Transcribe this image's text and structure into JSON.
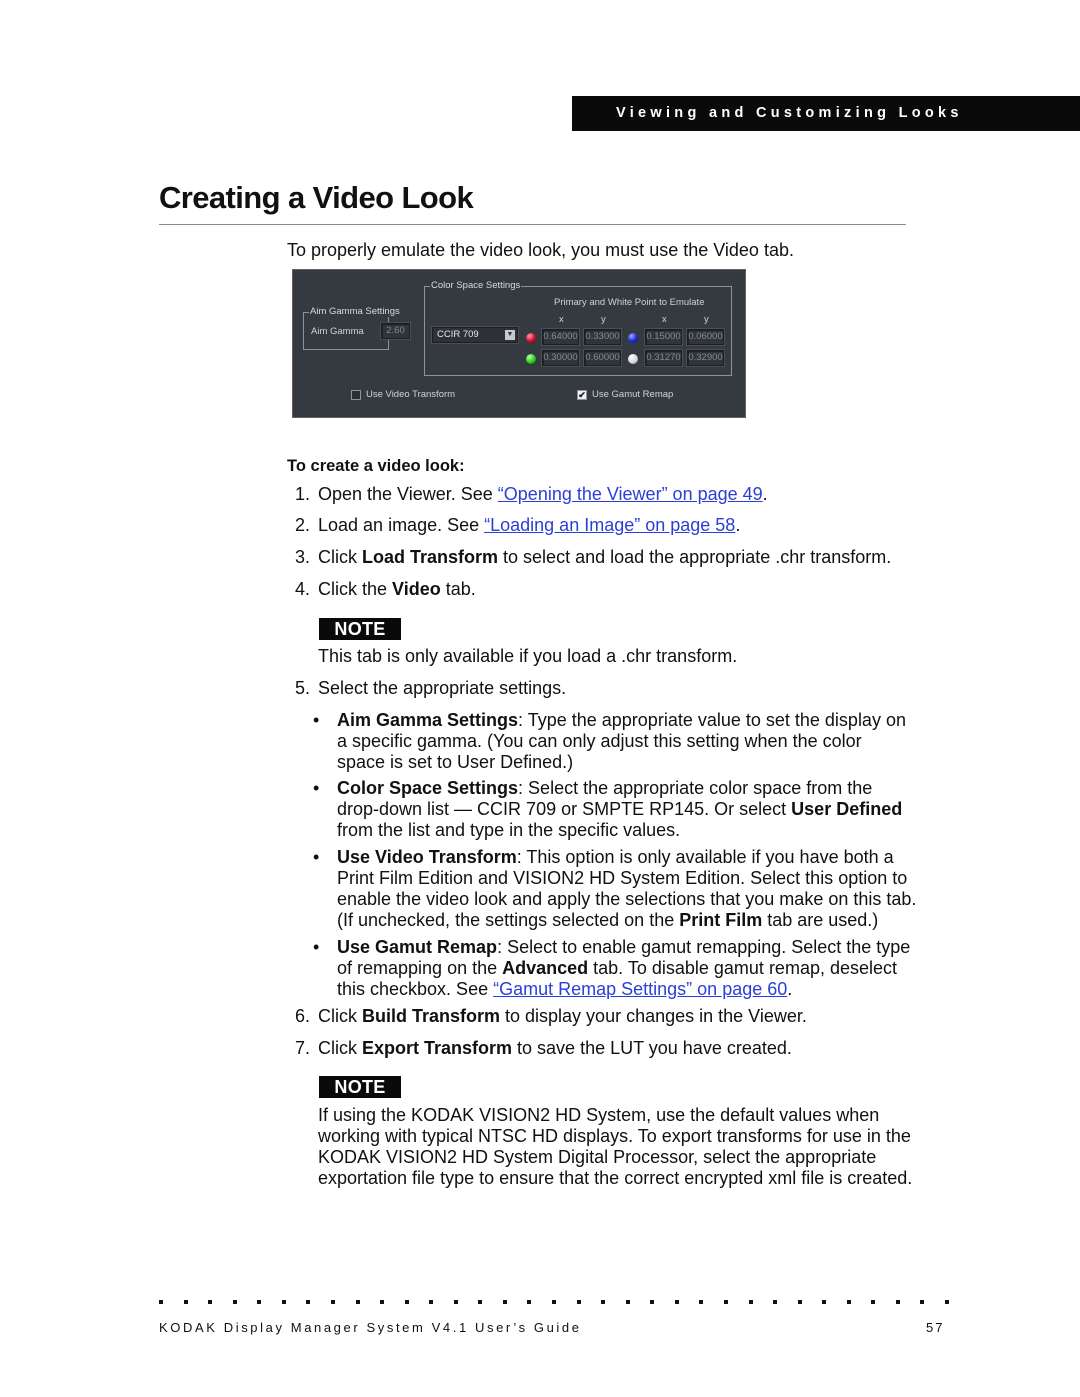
{
  "header": {
    "section_banner": "Viewing and Customizing Looks"
  },
  "page": {
    "title": "Creating a Video Look",
    "intro": "To properly emulate the video look, you must use the Video tab."
  },
  "app_panel": {
    "aim_gamma_group": {
      "title": "Aim Gamma Settings",
      "label": "Aim Gamma",
      "value": "2.60"
    },
    "color_space_group": {
      "title": "Color Space Settings",
      "subtitle": "Primary and White Point to Emulate",
      "selected_color_space": "CCIR 709",
      "col_headers": [
        "x",
        "y",
        "x",
        "y"
      ],
      "primaries": {
        "red": {
          "x": "0.64000",
          "y": "0.33000"
        },
        "green": {
          "x": "0.30000",
          "y": "0.60000"
        },
        "blue": {
          "x": "0.15000",
          "y": "0.06000"
        },
        "white": {
          "x": "0.31270",
          "y": "0.32900"
        }
      }
    },
    "use_video_transform": {
      "label": "Use Video Transform",
      "checked": false
    },
    "use_gamut_remap": {
      "label": "Use Gamut Remap",
      "checked": true,
      "check_glyph": "✔"
    },
    "dropdown_arrow": "▼"
  },
  "procedure": {
    "heading": "To create a video look:",
    "steps": [
      {
        "num": "1.",
        "pre": "Open the Viewer. See ",
        "link": "“Opening the Viewer” on page 49",
        "post": "."
      },
      {
        "num": "2.",
        "pre": "Load an image. See ",
        "link": "“Loading an Image” on page 58",
        "post": "."
      },
      {
        "num": "3.",
        "pre": "Click ",
        "bold": "Load Transform",
        "post": " to select and load the appropriate .chr transform."
      },
      {
        "num": "4.",
        "pre": "Click the ",
        "bold": "Video",
        "post": " tab."
      },
      {
        "num": "5.",
        "text": "Select the appropriate settings."
      },
      {
        "num": "6.",
        "pre": "Click ",
        "bold": "Build Transform",
        "post": " to display your changes in the Viewer."
      },
      {
        "num": "7.",
        "pre": "Click ",
        "bold": "Export Transform",
        "post": " to save the LUT you have created."
      }
    ],
    "note1": {
      "tag": "NOTE",
      "text": "This tab is only available if you load a .chr transform."
    },
    "bullets": [
      {
        "bold": "Aim Gamma Settings",
        "l1": ": Type the appropriate value to set the display on",
        "l2": "a specific gamma. (You can only adjust this setting when the color",
        "l3": "space is set to User Defined.)"
      },
      {
        "bold": "Color Space Settings",
        "l1": ": Select the appropriate color space from the",
        "l2": "drop-down list — CCIR 709 or SMPTE RP145. Or select ",
        "l2_bold": "User Defined",
        "l3": "from the list and type in the specific values."
      },
      {
        "bold": "Use Video Transform",
        "l1": ": This option is only available if you have both a",
        "l2": "Print Film Edition and VISION2 HD System Edition. Select this option to",
        "l3": "enable the video look and apply the selections that you make on this tab.",
        "l4_pre": "(If unchecked, the settings selected on the ",
        "l4_bold": "Print Film",
        "l4_post": " tab are used.)"
      },
      {
        "bold": "Use Gamut Remap",
        "l1": ": Select to enable gamut remapping. Select the type",
        "l2_pre": "of remapping on the ",
        "l2_bold": "Advanced",
        "l2_post": " tab. To disable gamut remap, deselect",
        "l3_pre": "this checkbox. See ",
        "l3_link": "“Gamut Remap Settings” on page 60",
        "l3_post": "."
      }
    ],
    "bullet_glyph": "•",
    "note2": {
      "tag": "NOTE",
      "lines": [
        "If using the KODAK VISION2 HD System, use the default values when",
        "working with typical NTSC HD displays. To export transforms for use in the",
        "KODAK VISION2 HD System Digital Processor, select the appropriate",
        "exportation file type to ensure that the correct encrypted xml file is created."
      ]
    }
  },
  "footer": {
    "guide_title": "KODAK Display Manager System V4.1 User’s Guide",
    "page_number": "57"
  },
  "colors": {
    "banner_bg": "#0a0a0a",
    "link": "#2a3fd8",
    "panel_bg": "#353a40"
  }
}
